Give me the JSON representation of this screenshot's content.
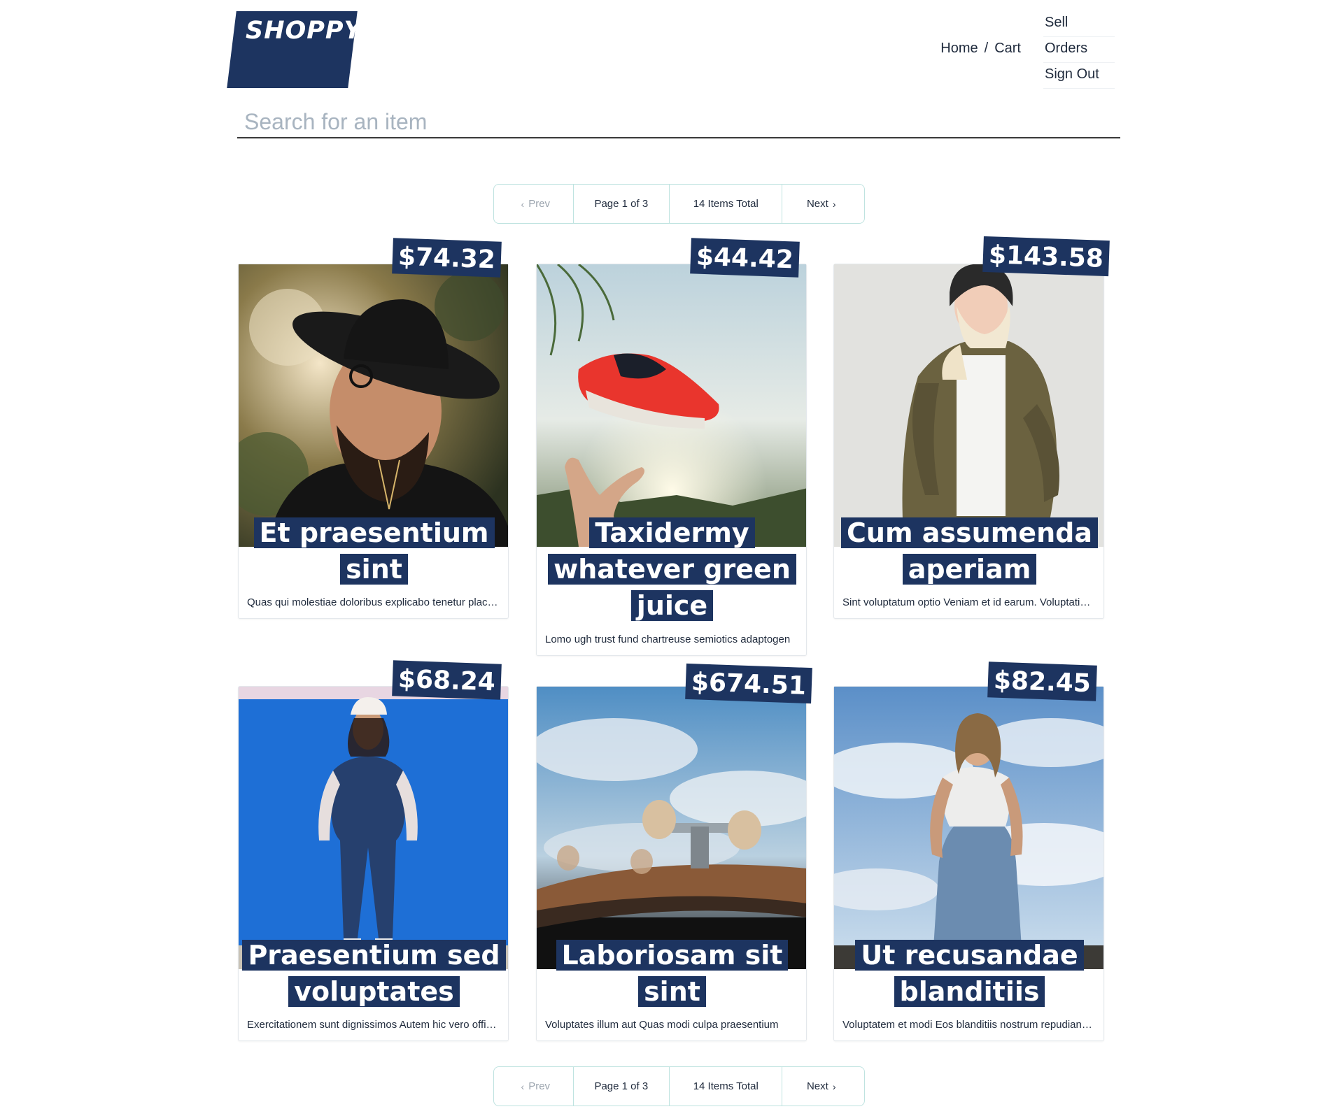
{
  "brand": {
    "logo": "SHOPPY"
  },
  "nav": {
    "breadcrumb": [
      {
        "label": "Home"
      },
      {
        "label": "Cart"
      }
    ],
    "separator": "/",
    "menu": [
      {
        "label": "Sell"
      },
      {
        "label": "Orders"
      },
      {
        "label": "Sign Out"
      }
    ]
  },
  "search": {
    "placeholder": "Search for an item",
    "value": ""
  },
  "pagination": {
    "prev": "Prev",
    "page_label": "Page 1 of 3",
    "total_label": "14 Items Total",
    "next": "Next",
    "prev_chevron": "‹",
    "next_chevron": "›"
  },
  "items": [
    {
      "title": "Et praesentium sint",
      "price": "$74.32",
      "description": "Quas qui molestiae doloribus explicabo tenetur placeat",
      "image": "bearded-man-in-black-hat"
    },
    {
      "title": "Taxidermy whatever green juice",
      "price": "$44.42",
      "description": "Lomo ugh trust fund chartreuse semiotics adaptogen",
      "image": "sneaker-flying-above-hand"
    },
    {
      "title": "Cum assumenda aperiam",
      "price": "$143.58",
      "description": "Sint voluptatum optio Veniam et id earum. Voluptatibus",
      "image": "woman-in-olive-jacket-and-beanie"
    },
    {
      "title": "Praesentium sed voluptates",
      "price": "$68.24",
      "description": "Exercitationem sunt dignissimos Autem hic vero officiis",
      "image": "woman-in-overalls-against-blue-wall"
    },
    {
      "title": "Laboriosam sit sint",
      "price": "$674.51",
      "description": "Voluptates illum aut Quas modi culpa praesentium",
      "image": "skateboard-under-sky"
    },
    {
      "title": "Ut recusandae blanditiis",
      "price": "$82.45",
      "description": "Voluptatem et modi Eos blanditiis nostrum repudiandae",
      "image": "woman-in-lace-top-under-cloudy-sky"
    }
  ],
  "colors": {
    "accent": "#1d3460",
    "pagination_border": "#bfe3e0",
    "placeholder": "#a8b4c0"
  }
}
